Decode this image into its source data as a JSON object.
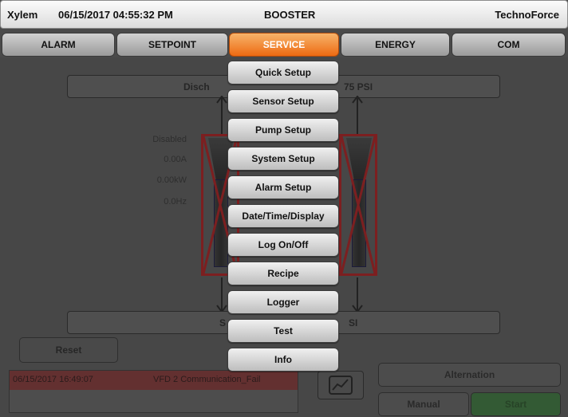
{
  "header": {
    "brand": "Xylem",
    "datetime": "06/15/2017 04:55:32 PM",
    "title": "BOOSTER",
    "company": "TechnoForce"
  },
  "tabs": [
    {
      "label": "ALARM"
    },
    {
      "label": "SETPOINT"
    },
    {
      "label": "SERVICE",
      "active": true
    },
    {
      "label": "ENERGY"
    },
    {
      "label": "COM"
    }
  ],
  "main": {
    "discharge_label_left": "Disch",
    "discharge_label_right": "75 PSI",
    "suction_label_left": "S",
    "suction_label_right": "SI",
    "pump_status": {
      "state": "Disabled",
      "current": "0.00A",
      "power": "0.00kW",
      "frequency": "0.0Hz"
    },
    "reset_label": "Reset",
    "alarm": {
      "timestamp": "06/15/2017 16:49:07",
      "message": "VFD 2 Communication_Fail"
    },
    "trend_icon": "trend-chart-icon",
    "alternation_label": "Alternation",
    "manual_label": "Manual",
    "start_label": "Start"
  },
  "service_menu": {
    "items": [
      "Quick Setup",
      "Sensor Setup",
      "Pump Setup",
      "System Setup",
      "Alarm Setup",
      "Date/Time/Display",
      "Log On/Off",
      "Recipe",
      "Logger",
      "Test",
      "Info"
    ]
  },
  "colors": {
    "active_tab": "#ee6a12",
    "alarm_row": "#c85c5c",
    "start_button": "#5cc761",
    "pump_fault": "#d43a3a"
  }
}
